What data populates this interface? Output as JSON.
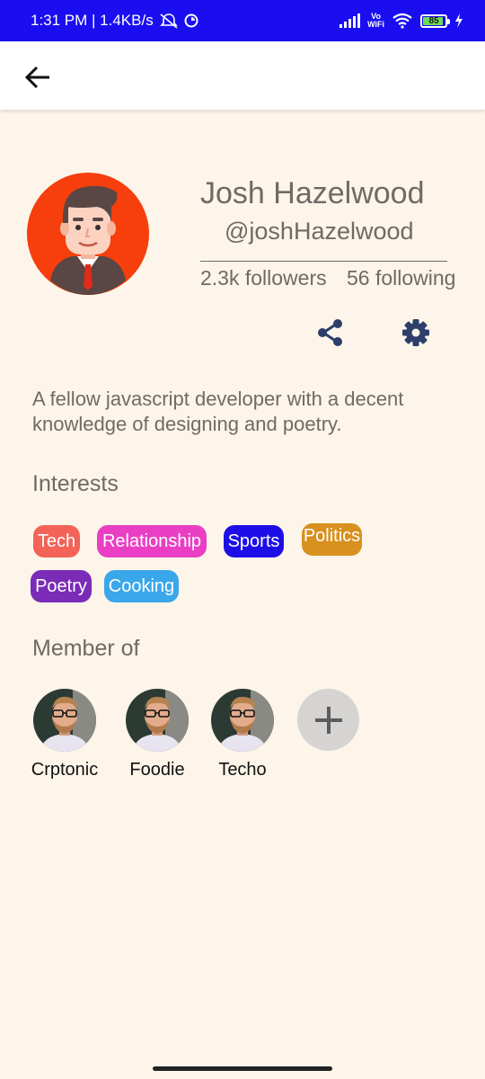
{
  "status_bar": {
    "time_speed": "1:31 PM | 1.4KB/s",
    "vo": "Vo",
    "wifi": "WiFi",
    "battery": "85"
  },
  "profile": {
    "name": "Josh Hazelwood",
    "handle": "@joshHazelwood",
    "followers": "2.3k followers",
    "following": "56 following",
    "bio": "A fellow javascript developer with a decent knowledge of designing and poetry."
  },
  "interests": {
    "title": "Interests",
    "chips": [
      {
        "label": "Tech",
        "color": "#f36358"
      },
      {
        "label": "Relationship",
        "color": "#ea3fc4"
      },
      {
        "label": "Sports",
        "color": "#1d0ee8"
      },
      {
        "label": "Politics",
        "color": "#d8901f"
      },
      {
        "label": "Poetry",
        "color": "#7b2cb7"
      },
      {
        "label": "Cooking",
        "color": "#3aa7ea"
      }
    ]
  },
  "members": {
    "title": "Member of",
    "groups": [
      {
        "label": "Crptonic"
      },
      {
        "label": "Foodie"
      },
      {
        "label": "Techo"
      }
    ]
  },
  "colors": {
    "status_bar": "#1a0ef0",
    "background": "#fdf5ea",
    "text_muted": "#6f6a66",
    "icon_navy": "#2d3e6b",
    "avatar_bg": "#f63f0c"
  },
  "icons": [
    "arrow-left-icon",
    "share-icon",
    "gear-icon",
    "plus-icon"
  ]
}
